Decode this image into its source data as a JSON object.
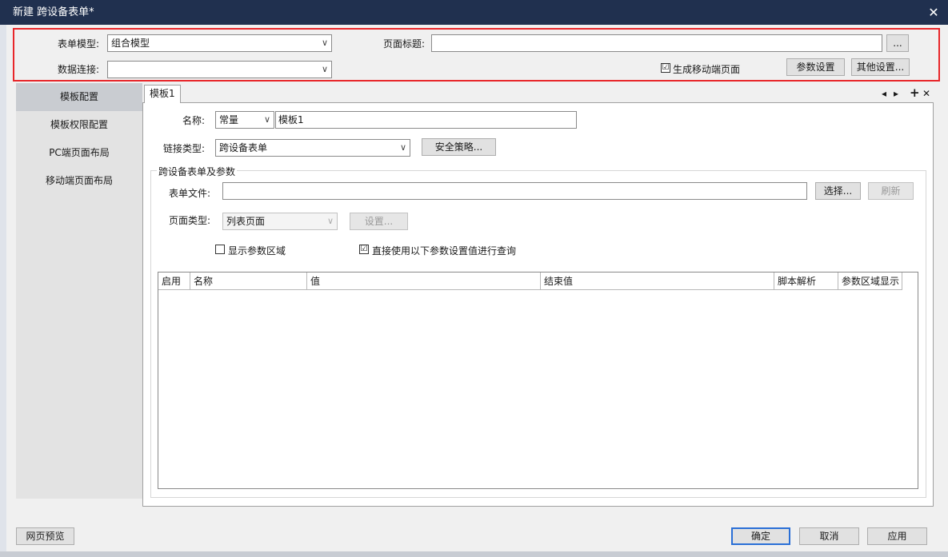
{
  "window": {
    "title": "新建 跨设备表单*",
    "close": "✕"
  },
  "top": {
    "form_model_label": "表单模型:",
    "form_model_value": "组合模型",
    "data_conn_label": "数据连接:",
    "data_conn_value": "",
    "page_title_label": "页面标题:",
    "page_title_value": "",
    "browse_label": "...",
    "gen_mobile_label": "生成移动端页面",
    "gen_mobile_checked": "☑",
    "param_settings_label": "参数设置",
    "other_settings_label": "其他设置..."
  },
  "nav": {
    "items": [
      {
        "label": "模板配置"
      },
      {
        "label": "模板权限配置"
      },
      {
        "label": "PC端页面布局"
      },
      {
        "label": "移动端页面布局"
      }
    ]
  },
  "tabs": {
    "active_label": "模板1",
    "controls": {
      "prev": "◂",
      "next": "▸",
      "add": "+",
      "close": "✕"
    }
  },
  "template": {
    "name_label": "名称:",
    "name_type": "常量",
    "name_value": "模板1",
    "link_type_label": "链接类型:",
    "link_type_value": "跨设备表单",
    "security_label": "安全策略...",
    "group_title": "跨设备表单及参数",
    "form_file_label": "表单文件:",
    "form_file_value": "",
    "choose_label": "选择...",
    "refresh_label": "刷新",
    "page_type_label": "页面类型:",
    "page_type_value": "列表页面",
    "settings_label": "设置...",
    "show_params_label": "显示参数区域",
    "use_params_label": "直接使用以下参数设置值进行查询",
    "use_params_checked": "☑"
  },
  "table": {
    "columns": [
      "启用",
      "名称",
      "值",
      "结束值",
      "脚本解析",
      "参数区域显示"
    ],
    "rows": []
  },
  "footer": {
    "preview_label": "网页预览",
    "ok_label": "确定",
    "cancel_label": "取消",
    "apply_label": "应用"
  },
  "colors": {
    "titlebar": "#20304f",
    "highlight": "#e8262a",
    "primary_border": "#2a6fd6"
  }
}
